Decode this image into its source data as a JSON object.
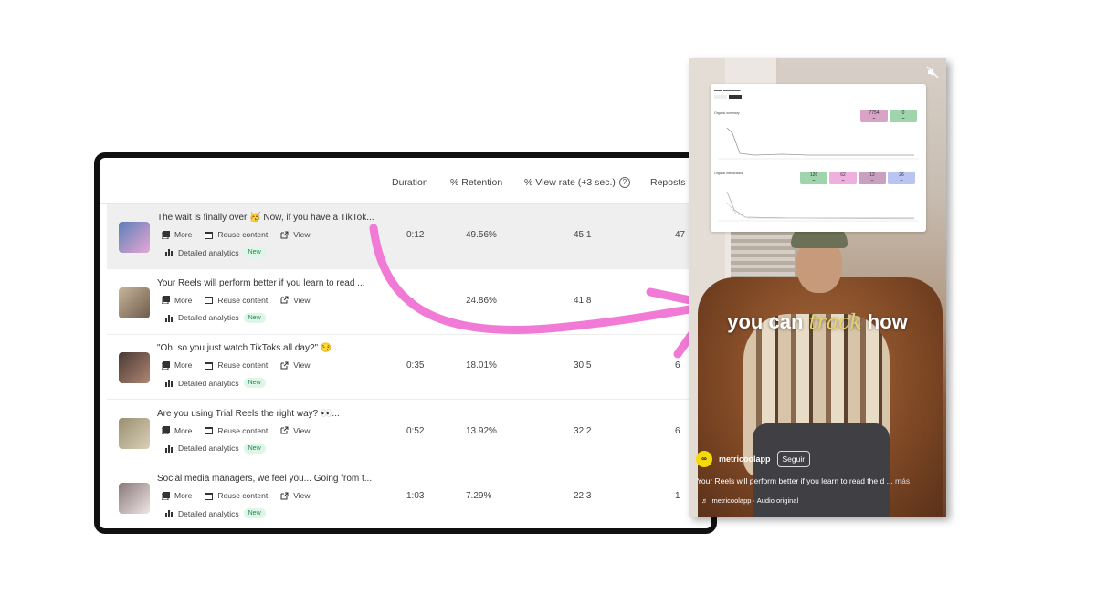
{
  "table": {
    "headers": {
      "duration": "Duration",
      "retention": "% Retention",
      "view_rate": "% View rate (+3 sec.)",
      "reposts": "Reposts"
    },
    "action_labels": {
      "more": "More",
      "reuse": "Reuse content",
      "view": "View",
      "analytics": "Detailed analytics",
      "new_badge": "New"
    },
    "rows": [
      {
        "title": "The wait is finally over 🥳 Now, if you have a TikTok...",
        "duration": "0:12",
        "retention": "49.56%",
        "view_rate": "45.1",
        "reposts": "47"
      },
      {
        "title": "Your Reels will perform better if you learn to read ...",
        "duration": "0:",
        "retention": "24.86%",
        "view_rate": "41.8",
        "reposts": ""
      },
      {
        "title": "\"Oh, so you just watch TikToks all day?\" 😏...",
        "duration": "0:35",
        "retention": "18.01%",
        "view_rate": "30.5",
        "reposts": "6"
      },
      {
        "title": "Are you using Trial Reels the right way? 👀...",
        "duration": "0:52",
        "retention": "13.92%",
        "view_rate": "32.2",
        "reposts": "6"
      },
      {
        "title": "Social media managers, we feel you... Going from t...",
        "duration": "1:03",
        "retention": "7.29%",
        "view_rate": "22.3",
        "reposts": "1"
      }
    ]
  },
  "video": {
    "overlay_pre": "you can ",
    "overlay_highlight": "track",
    "overlay_post": " how",
    "creator": "metricoolapp",
    "follow": "Seguir",
    "caption": "Your Reels will perform better if you learn to read the d ...",
    "caption_more": "más",
    "audio": "metricoolapp · Audio original",
    "dashboard": {
      "organic_summary": "Organic summary",
      "organic_interactions": "Organic interactions",
      "kpis": [
        "7754",
        "0",
        "126",
        "62",
        "12",
        "26"
      ]
    }
  },
  "colors": {
    "arrow": "#f07ad6",
    "new_badge_bg": "#dff5e8",
    "new_badge_text": "#1d8a52"
  }
}
